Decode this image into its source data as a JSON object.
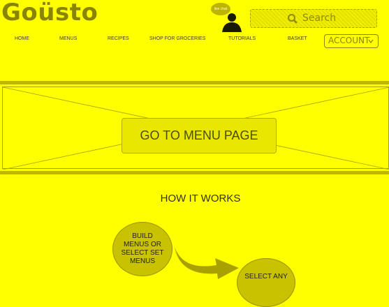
{
  "brand": {
    "logo_text": "Goüsto"
  },
  "chat": {
    "bubble_text": "live chat"
  },
  "search": {
    "placeholder": "Search"
  },
  "nav": {
    "items": [
      {
        "label": "HOME"
      },
      {
        "label": "MENUS"
      },
      {
        "label": "RECIPES"
      },
      {
        "label": "SHOP FOR GROCERIES"
      },
      {
        "label": "TUTORIALS"
      },
      {
        "label": "BASKET"
      }
    ],
    "account_label": "ACCOUNT"
  },
  "banner": {
    "button_label": "GO TO MENU PAGE"
  },
  "how": {
    "title": "HOW IT WORKS",
    "steps": [
      {
        "label": "BUILD MENUS OR SELECT SET MENUS"
      },
      {
        "label": "SELECT ANY"
      }
    ]
  },
  "colors": {
    "background": "#ffff00",
    "accent": "#8a8500"
  }
}
